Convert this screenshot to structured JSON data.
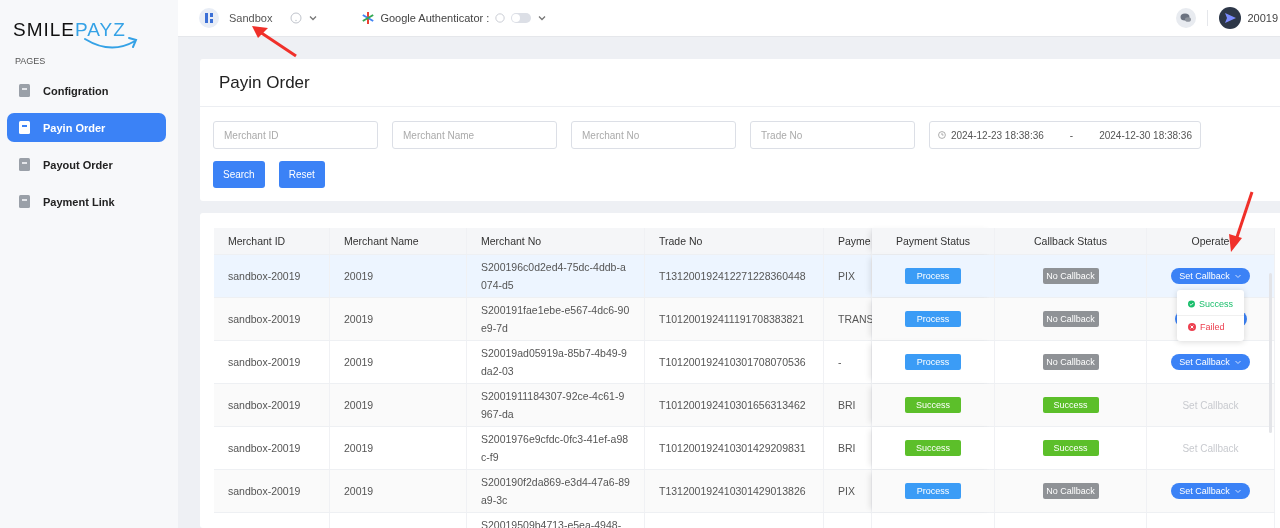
{
  "brand": {
    "first": "SMILE",
    "second": "PAYZ"
  },
  "sidebar": {
    "section": "PAGES",
    "items": [
      {
        "label": "Configration",
        "selected": false
      },
      {
        "label": "Payin Order",
        "selected": true
      },
      {
        "label": "Payout Order",
        "selected": false
      },
      {
        "label": "Payment Link",
        "selected": false
      }
    ]
  },
  "topbar": {
    "environment": "Sandbox",
    "authenticator": {
      "label": "Google Authenticator :",
      "on": false
    },
    "user": "20019"
  },
  "page_title": "Payin Order",
  "filters": [
    {
      "placeholder": "Merchant ID"
    },
    {
      "placeholder": "Merchant Name"
    },
    {
      "placeholder": "Merchant No"
    },
    {
      "placeholder": "Trade No"
    }
  ],
  "date_range": {
    "start": "2024-12-23 18:38:36",
    "separator": "-",
    "end": "2024-12-30 18:38:36"
  },
  "buttons": [
    "Search",
    "Reset"
  ],
  "table": {
    "columns": [
      "Merchant ID",
      "Merchant Name",
      "Merchant No",
      "Trade No",
      "Payme",
      "Payment Status",
      "Callback Status",
      "Operate"
    ],
    "rows": [
      {
        "merchant_id": "sandbox-20019",
        "merchant_name": "20019",
        "merchant_no": "S200196c0d2ed4-75dc-4ddb-a074-d5",
        "trade_no": "T131200192412271228360448",
        "payment": "PIX",
        "payment_status": {
          "label": "Process",
          "kind": "process"
        },
        "callback_status": {
          "label": "No Callback",
          "kind": "none"
        },
        "operate": {
          "label": "Set Callback",
          "disabled": false,
          "menu": [
            {
              "label": "Success",
              "kind": "success"
            },
            {
              "label": "Failed",
              "kind": "failed"
            }
          ]
        },
        "highlighted": true
      },
      {
        "merchant_id": "sandbox-20019",
        "merchant_name": "20019",
        "merchant_no": "S200191fae1ebe-e567-4dc6-90e9-7d",
        "trade_no": "T101200192411191708383821",
        "payment": "TRANS",
        "payment_status": {
          "label": "Process",
          "kind": "process"
        },
        "callback_status": {
          "label": "No Callback",
          "kind": "none"
        },
        "operate": {
          "disabled": false
        },
        "highlighted": false
      },
      {
        "merchant_id": "sandbox-20019",
        "merchant_name": "20019",
        "merchant_no": "S20019ad05919a-85b7-4b49-9da2-03",
        "trade_no": "T101200192410301708070536",
        "payment": "-",
        "payment_status": {
          "label": "Process",
          "kind": "process"
        },
        "callback_status": {
          "label": "No Callback",
          "kind": "none"
        },
        "operate": {
          "label": "Set Callback",
          "disabled": false
        },
        "highlighted": false
      },
      {
        "merchant_id": "sandbox-20019",
        "merchant_name": "20019",
        "merchant_no": "S2001911184307-92ce-4c61-9967-da",
        "trade_no": "T101200192410301656313462",
        "payment": "BRI",
        "payment_status": {
          "label": "Success",
          "kind": "success"
        },
        "callback_status": {
          "label": "Success",
          "kind": "success"
        },
        "operate": {
          "label": "Set Callback",
          "disabled": true
        },
        "highlighted": false
      },
      {
        "merchant_id": "sandbox-20019",
        "merchant_name": "20019",
        "merchant_no": "S2001976e9cfdc-0fc3-41ef-a98c-f9",
        "trade_no": "T101200192410301429209831",
        "payment": "BRI",
        "payment_status": {
          "label": "Success",
          "kind": "success"
        },
        "callback_status": {
          "label": "Success",
          "kind": "success"
        },
        "operate": {
          "label": "Set Callback",
          "disabled": true
        },
        "highlighted": false
      },
      {
        "merchant_id": "sandbox-20019",
        "merchant_name": "20019",
        "merchant_no": "S200190f2da869-e3d4-47a6-89a9-3c",
        "trade_no": "T131200192410301429013826",
        "payment": "PIX",
        "payment_status": {
          "label": "Process",
          "kind": "process"
        },
        "callback_status": {
          "label": "No Callback",
          "kind": "none"
        },
        "operate": {
          "label": "Set Callback",
          "disabled": false
        },
        "highlighted": false
      },
      {
        "merchant_no": "S20019509b4713-e5ea-4948-"
      }
    ]
  }
}
